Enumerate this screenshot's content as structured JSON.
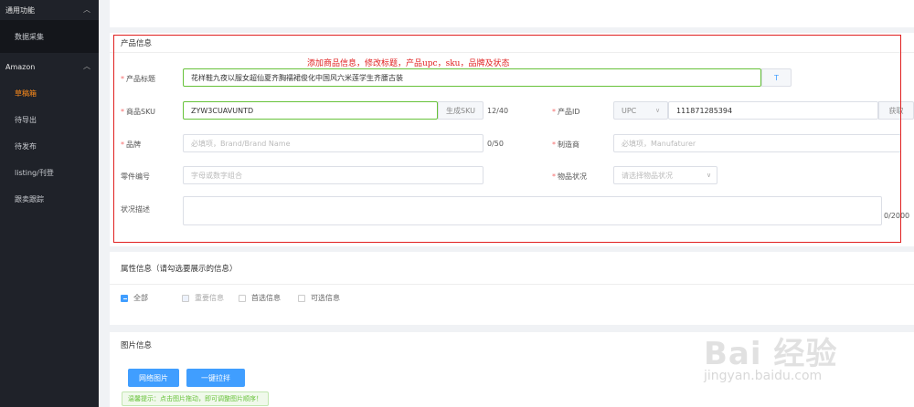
{
  "sidebar": {
    "group1": {
      "label": "通用功能"
    },
    "group1_items": [
      {
        "label": "数据采集"
      }
    ],
    "group2": {
      "label": "Amazon"
    },
    "group2_items": [
      {
        "label": "草稿箱"
      },
      {
        "label": "待导出"
      },
      {
        "label": "待发布"
      },
      {
        "label": "listing/刊登"
      },
      {
        "label": "跟卖跟踪"
      }
    ]
  },
  "annotation": "添加商品信息，修改标题，产品upc，sku，品牌及状态",
  "product": {
    "section_title": "产品信息",
    "title_label": "产品标题",
    "title_value": "花样鞋九夜以服女超仙夏齐胸襦裙俊化中国风六米莲学生齐腰古装",
    "title_btn": "T",
    "sku_label": "商品SKU",
    "sku_value": "ZYW3CUAVUNTD",
    "sku_btn": "生成SKU",
    "sku_counter": "12/40",
    "pid_label": "产品ID",
    "pid_type": "UPC",
    "pid_value": "111871285394",
    "pid_btn": "获取",
    "brand_label": "品牌",
    "brand_placeholder": "必填项，Brand/Brand Name",
    "brand_counter": "0/50",
    "maker_label": "制造商",
    "maker_placeholder": "必填项，Manufaturer",
    "part_label": "零件编号",
    "part_placeholder": "字母或数字组合",
    "cond_label": "物品状况",
    "cond_placeholder": "请选择物品状况",
    "desc_label": "状况描述",
    "desc_counter": "0/2000"
  },
  "attributes": {
    "section_title": "属性信息（请勾选要展示的信息）",
    "options": [
      {
        "label": "全部"
      },
      {
        "label": "重要信息"
      },
      {
        "label": "首选信息"
      },
      {
        "label": "可选信息"
      }
    ]
  },
  "images": {
    "section_title": "图片信息",
    "btn_network": "网络图片",
    "btn_pull": "一键拉拌",
    "tip": "温馨提示：点击图片拖动，即可调整图片顺序！"
  },
  "watermark": {
    "main": "Bai 经验",
    "sub": "jingyan.baidu.com"
  }
}
